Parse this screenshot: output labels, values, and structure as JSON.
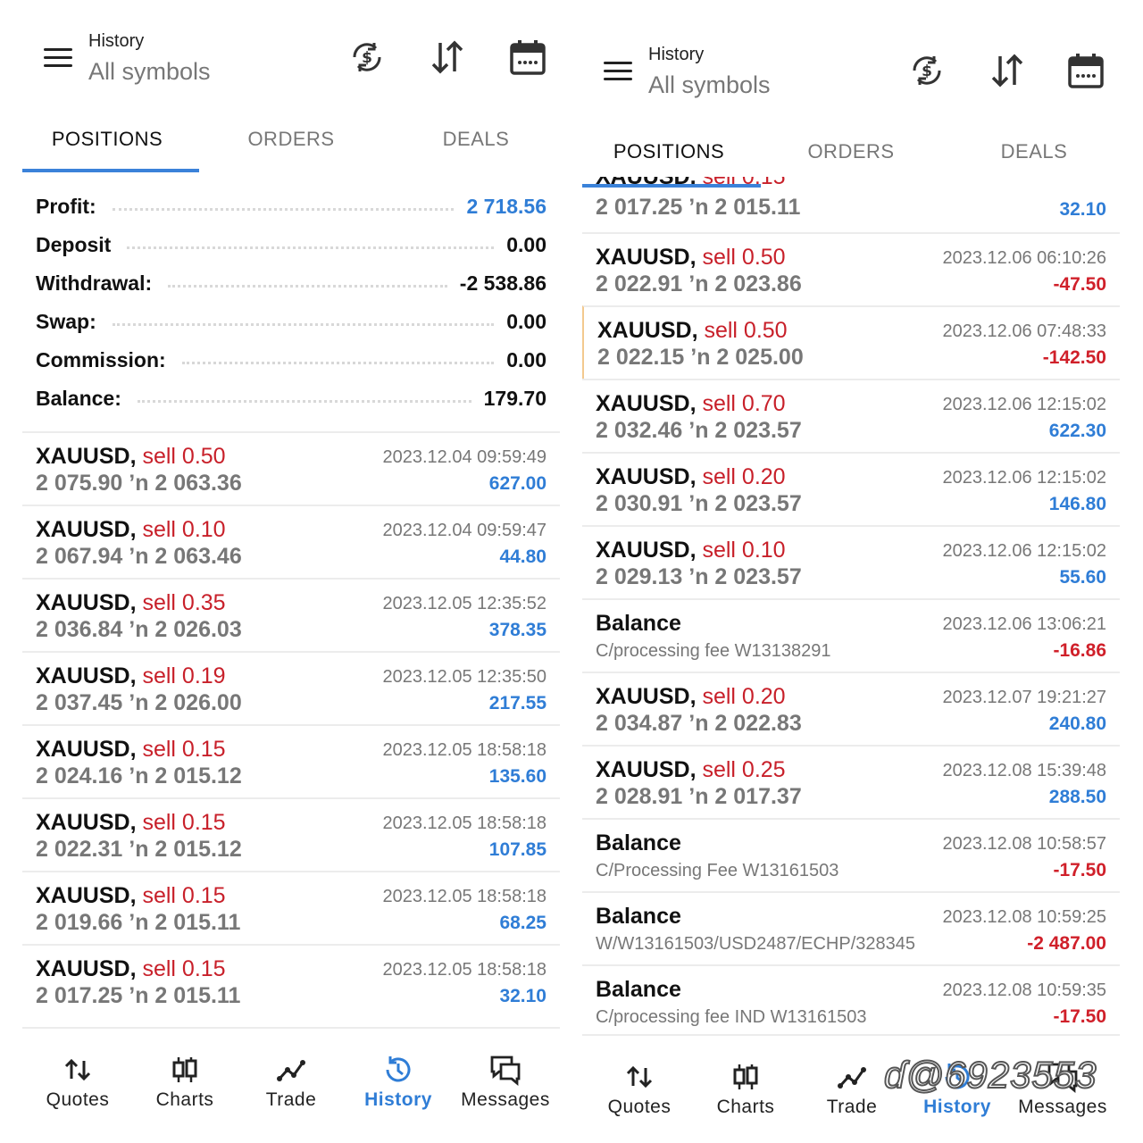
{
  "left": {
    "header": {
      "subtitle": "History",
      "title": "All symbols"
    },
    "tabs": [
      "POSITIONS",
      "ORDERS",
      "DEALS"
    ],
    "summary": [
      {
        "label": "Profit:",
        "value": "2 718.56"
      },
      {
        "label": "Deposit",
        "value": "0.00"
      },
      {
        "label": "Withdrawal:",
        "value": "-2 538.86"
      },
      {
        "label": "Swap:",
        "value": "0.00"
      },
      {
        "label": "Commission:",
        "value": "0.00"
      },
      {
        "label": "Balance:",
        "value": "179.70"
      }
    ],
    "rows": [
      {
        "symbol": "XAUUSD,",
        "side": "sell 0.50",
        "prices": "2 075.90 ’n  2 063.36",
        "date": "2023.12.04 09:59:49",
        "amount": "627.00",
        "sign": "pos"
      },
      {
        "symbol": "XAUUSD,",
        "side": "sell 0.10",
        "prices": "2 067.94 ’n  2 063.46",
        "date": "2023.12.04 09:59:47",
        "amount": "44.80",
        "sign": "pos"
      },
      {
        "symbol": "XAUUSD,",
        "side": "sell 0.35",
        "prices": "2 036.84 ’n  2 026.03",
        "date": "2023.12.05 12:35:52",
        "amount": "378.35",
        "sign": "pos"
      },
      {
        "symbol": "XAUUSD,",
        "side": "sell 0.19",
        "prices": "2 037.45 ’n  2 026.00",
        "date": "2023.12.05 12:35:50",
        "amount": "217.55",
        "sign": "pos"
      },
      {
        "symbol": "XAUUSD,",
        "side": "sell 0.15",
        "prices": "2 024.16 ’n  2 015.12",
        "date": "2023.12.05 18:58:18",
        "amount": "135.60",
        "sign": "pos"
      },
      {
        "symbol": "XAUUSD,",
        "side": "sell 0.15",
        "prices": "2 022.31 ’n  2 015.12",
        "date": "2023.12.05 18:58:18",
        "amount": "107.85",
        "sign": "pos"
      },
      {
        "symbol": "XAUUSD,",
        "side": "sell 0.15",
        "prices": "2 019.66 ’n  2 015.11",
        "date": "2023.12.05 18:58:18",
        "amount": "68.25",
        "sign": "pos"
      },
      {
        "symbol": "XAUUSD,",
        "side": "sell 0.15",
        "prices": "2 017.25 ’n  2 015.11",
        "date": "2023.12.05 18:58:18",
        "amount": "32.10",
        "sign": "pos"
      }
    ]
  },
  "right": {
    "header": {
      "subtitle": "History",
      "title": "All symbols"
    },
    "tabs": [
      "POSITIONS",
      "ORDERS",
      "DEALS"
    ],
    "partial_row": {
      "prices": "2 017.25 ’n  2 015.11",
      "amount": "32.10"
    },
    "rows": [
      {
        "symbol": "XAUUSD,",
        "side": "sell 0.50",
        "prices": "2 022.91 ’n  2 023.86",
        "date": "2023.12.06 06:10:26",
        "amount": "-47.50",
        "sign": "neg"
      },
      {
        "symbol": "XAUUSD,",
        "side": "sell 0.50",
        "prices": "2 022.15 ’n  2 025.00",
        "date": "2023.12.06 07:48:33",
        "amount": "-142.50",
        "sign": "neg"
      },
      {
        "symbol": "XAUUSD,",
        "side": "sell 0.70",
        "prices": "2 032.46 ’n  2 023.57",
        "date": "2023.12.06 12:15:02",
        "amount": "622.30",
        "sign": "pos"
      },
      {
        "symbol": "XAUUSD,",
        "side": "sell 0.20",
        "prices": "2 030.91 ’n  2 023.57",
        "date": "2023.12.06 12:15:02",
        "amount": "146.80",
        "sign": "pos"
      },
      {
        "symbol": "XAUUSD,",
        "side": "sell 0.10",
        "prices": "2 029.13 ’n  2 023.57",
        "date": "2023.12.06 12:15:02",
        "amount": "55.60",
        "sign": "pos"
      },
      {
        "symbol": "Balance",
        "side": "",
        "prices": "C/processing fee W13138291",
        "date": "2023.12.06 13:06:21",
        "amount": "-16.86",
        "sign": "neg",
        "comment": true
      },
      {
        "symbol": "XAUUSD,",
        "side": "sell 0.20",
        "prices": "2 034.87 ’n  2 022.83",
        "date": "2023.12.07 19:21:27",
        "amount": "240.80",
        "sign": "pos"
      },
      {
        "symbol": "XAUUSD,",
        "side": "sell 0.25",
        "prices": "2 028.91 ’n  2 017.37",
        "date": "2023.12.08 15:39:48",
        "amount": "288.50",
        "sign": "pos"
      },
      {
        "symbol": "Balance",
        "side": "",
        "prices": "C/Processing Fee W13161503",
        "date": "2023.12.08 10:58:57",
        "amount": "-17.50",
        "sign": "neg",
        "comment": true
      },
      {
        "symbol": "Balance",
        "side": "",
        "prices": "W/W13161503/USD2487/ECHP/328345",
        "date": "2023.12.08 10:59:25",
        "amount": "-2 487.00",
        "sign": "neg",
        "comment": true
      },
      {
        "symbol": "Balance",
        "side": "",
        "prices": "C/processing fee IND W13161503",
        "date": "2023.12.08 10:59:35",
        "amount": "-17.50",
        "sign": "neg",
        "comment": true
      }
    ]
  },
  "nav": [
    "Quotes",
    "Charts",
    "Trade",
    "History",
    "Messages"
  ],
  "active_nav": "History",
  "watermark": "ɗ@6923553",
  "colors": {
    "accent": "#2f7dd6",
    "negative": "#d0202a",
    "sell": "#c8202a",
    "muted": "#777777"
  }
}
